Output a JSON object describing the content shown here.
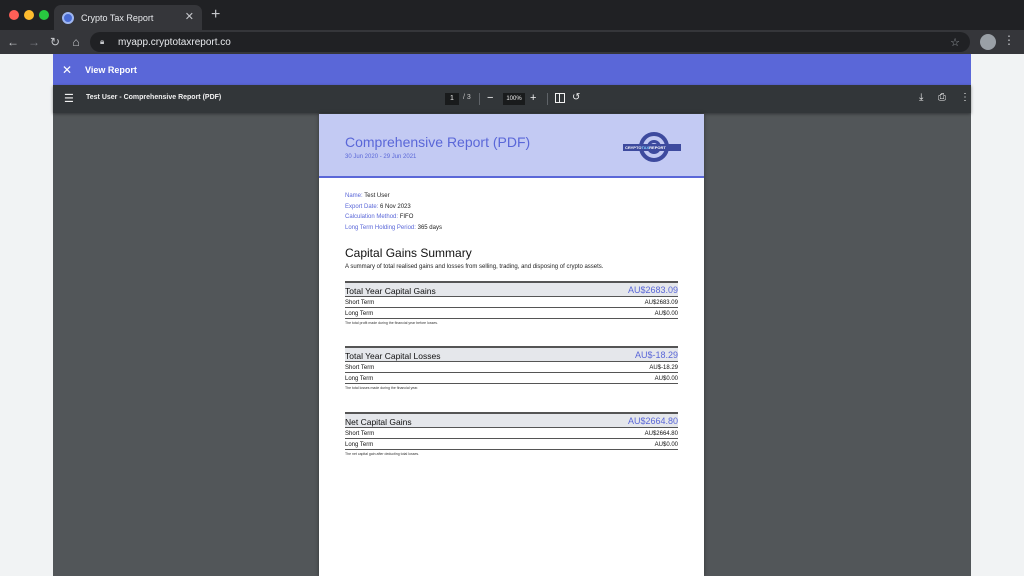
{
  "browser": {
    "tab_title": "Crypto Tax Report",
    "url": "myapp.cryptotaxreport.co"
  },
  "app": {
    "header_title": "View Report"
  },
  "pdf_viewer": {
    "document_title": "Test User - Comprehensive Report (PDF)",
    "current_page": "1",
    "page_total": "/ 3",
    "zoom": "100%"
  },
  "report": {
    "title": "Comprehensive Report (PDF)",
    "date_range": "30 Jun 2020 - 29 Jun 2021",
    "logo_text_left": "CRYPTO",
    "logo_text_right": "TAX",
    "logo_text_end": "REPORT",
    "meta": [
      {
        "key": "Name:",
        "value": "Test User"
      },
      {
        "key": "Export Date:",
        "value": "6 Nov 2023"
      },
      {
        "key": "Calculation Method:",
        "value": "FIFO"
      },
      {
        "key": "Long Term Holding Period:",
        "value": "365 days"
      }
    ],
    "summary_title": "Capital Gains Summary",
    "summary_desc": "A summary of total realised gains and losses from selling, trading, and disposing of crypto assets.",
    "blocks": [
      {
        "label": "Total Year Capital Gains",
        "total": "AU$2683.09",
        "rows": [
          {
            "label": "Short Term",
            "value": "AU$2683.09"
          },
          {
            "label": "Long Term",
            "value": "AU$0.00"
          }
        ],
        "note": "The total profit made during the financial year before losses."
      },
      {
        "label": "Total Year Capital Losses",
        "total": "AU$-18.29",
        "rows": [
          {
            "label": "Short Term",
            "value": "AU$-18.29"
          },
          {
            "label": "Long Term",
            "value": "AU$0.00"
          }
        ],
        "note": "The total losses made during the financial year."
      },
      {
        "label": "Net Capital Gains",
        "total": "AU$2664.80",
        "rows": [
          {
            "label": "Short Term",
            "value": "AU$2664.80"
          },
          {
            "label": "Long Term",
            "value": "AU$0.00"
          }
        ],
        "note": "The net capital gain after deducting total losses."
      }
    ]
  },
  "colors": {
    "accent": "#5a67d8",
    "header_band": "#c3caf3"
  }
}
